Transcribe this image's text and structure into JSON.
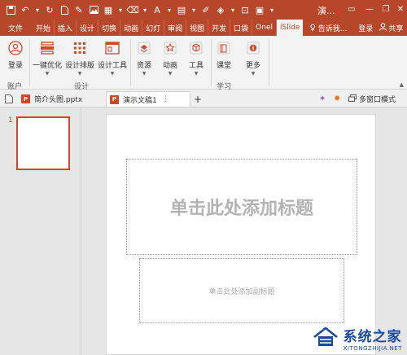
{
  "window": {
    "title": "演...",
    "brand_color": "#b7472a"
  },
  "ribbon_tabs": [
    {
      "label": "文件"
    },
    {
      "label": "开始"
    },
    {
      "label": "插入"
    },
    {
      "label": "设计"
    },
    {
      "label": "切换"
    },
    {
      "label": "动画"
    },
    {
      "label": "幻灯"
    },
    {
      "label": "审阅"
    },
    {
      "label": "视图"
    },
    {
      "label": "开发"
    },
    {
      "label": "口袋"
    },
    {
      "label": "Onel"
    },
    {
      "label": "iSlide"
    }
  ],
  "tell_me": "告诉我...",
  "login": "登录",
  "share": "共享",
  "ribbon": {
    "login_button": "登录",
    "group_account": "账户",
    "one_click_optimize": "一键优化",
    "design_layout": "设计排版",
    "design_tools": "设计工具",
    "group_design": "设计",
    "resources": "资源",
    "animation": "动画",
    "tools": "工具",
    "classroom": "课堂",
    "more": "更多",
    "group_learn": "学习"
  },
  "doc_tabs": {
    "tab1": "简介头图.pptx",
    "tab2": "演示文稿1",
    "multi_window": "多窗口模式"
  },
  "slides_pane": {
    "slide_number": "1"
  },
  "slide": {
    "title_placeholder": "单击此处添加标题",
    "subtitle_placeholder": "单击此处添加副标题"
  },
  "watermark": {
    "title": "系统之家",
    "url": "XITONGZHIJIA.NET"
  }
}
